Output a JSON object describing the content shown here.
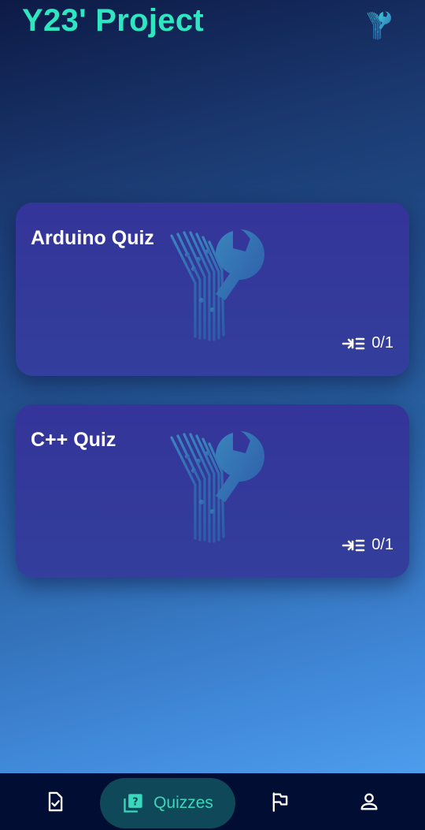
{
  "header": {
    "title": "Y23' Project",
    "logo_icon": "wrench-circuit-logo-icon"
  },
  "quizzes": [
    {
      "title": "Arduino Quiz",
      "progress": "0/1",
      "progress_icon": "arrow-to-list-icon",
      "background_icon": "wrench-circuit-logo-icon"
    },
    {
      "title": "C++ Quiz",
      "progress": "0/1",
      "progress_icon": "arrow-to-list-icon",
      "background_icon": "wrench-circuit-logo-icon"
    }
  ],
  "bottom_nav": {
    "active": "quizzes",
    "items": [
      {
        "id": "tasks",
        "icon": "document-check-icon"
      },
      {
        "id": "quizzes",
        "icon": "question-cards-icon",
        "label": "Quizzes"
      },
      {
        "id": "challenges",
        "icon": "flag-icon"
      },
      {
        "id": "profile",
        "icon": "person-icon"
      }
    ]
  },
  "colors": {
    "accent": "#2ee6c0",
    "card": "#34349a",
    "nav_bar": "#020d34",
    "nav_active_pill": "#0f4858"
  }
}
